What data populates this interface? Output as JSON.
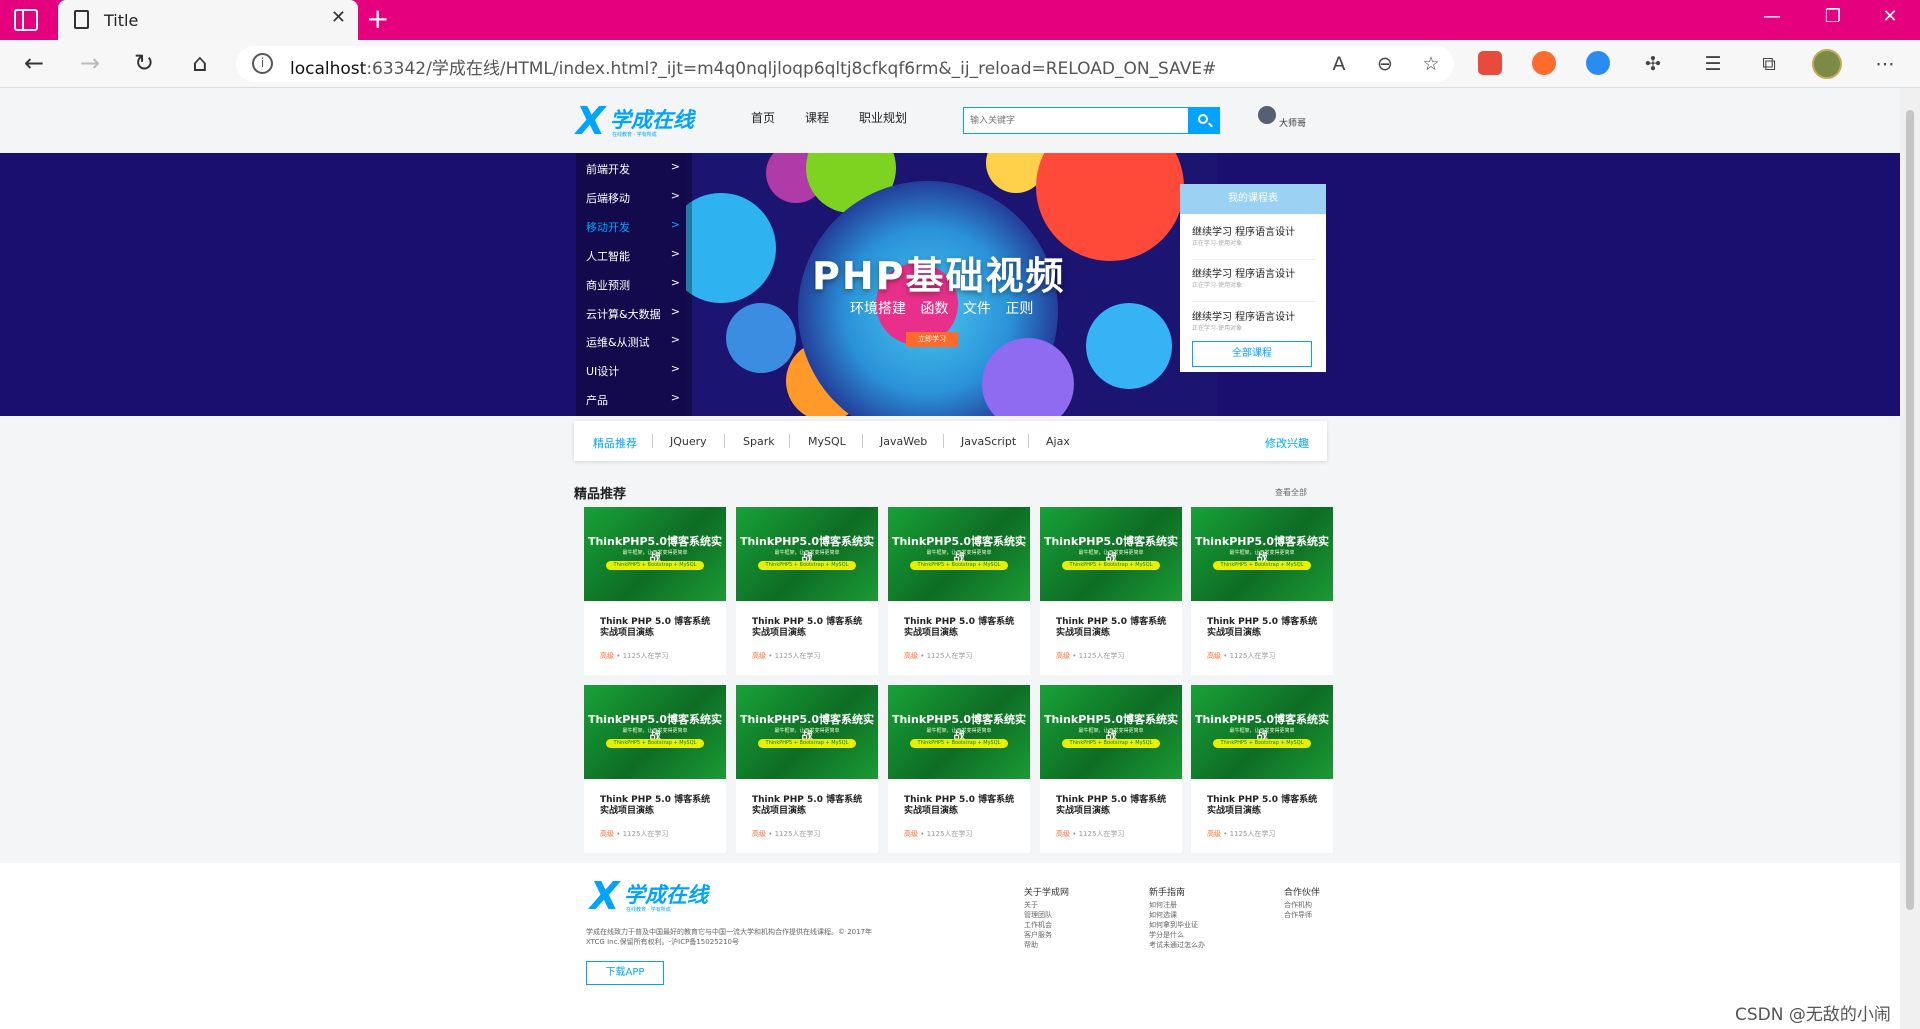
{
  "browser": {
    "tab_title": "Title",
    "url_host": "localhost",
    "url_rest": ":63342/学成在线/HTML/index.html?_ijt=m4q0nqljloqp6qltj8cfkqf6rm&_ij_reload=RELOAD_ON_SAVE#"
  },
  "header": {
    "logo_text": "学成在线",
    "logo_slogan": "在线教育 · 学有所成",
    "nav": [
      "首页",
      "课程",
      "职业规划"
    ],
    "search_placeholder": "输入关键字",
    "user_name": "大师哥"
  },
  "banner": {
    "side_menu": [
      {
        "label": "前端开发",
        "arrow": ">",
        "active": false
      },
      {
        "label": "后端移动",
        "arrow": ">",
        "active": false
      },
      {
        "label": "移动开发",
        "arrow": ">",
        "active": true
      },
      {
        "label": "人工智能",
        "arrow": ">",
        "active": false
      },
      {
        "label": "商业预测",
        "arrow": ">",
        "active": false
      },
      {
        "label": "云计算&大数据",
        "arrow": ">",
        "active": false
      },
      {
        "label": "运维&从测试",
        "arrow": ">",
        "active": false
      },
      {
        "label": "UI设计",
        "arrow": ">",
        "active": false
      },
      {
        "label": "产品",
        "arrow": ">",
        "active": false
      }
    ],
    "hero_title": "PHP基础视频",
    "hero_subtitle": "环境搭建 函数 文件 正则",
    "hero_button": "立即学习",
    "my_courses": {
      "title": "我的课程表",
      "items": [
        {
          "title": "继续学习 程序语言设计",
          "sub": "正在学习-使用对象"
        },
        {
          "title": "继续学习 程序语言设计",
          "sub": "正在学习-使用对象"
        },
        {
          "title": "继续学习 程序语言设计",
          "sub": "正在学习-使用对象"
        }
      ],
      "all_button": "全部课程"
    }
  },
  "subjects": {
    "items": [
      "精品推荐",
      "JQuery",
      "Spark",
      "MySQL",
      "JavaWeb",
      "JavaScript",
      "Ajax"
    ],
    "edit": "修改兴趣"
  },
  "section": {
    "title": "精品推荐",
    "view_all": "查看全部",
    "cards": [
      {
        "thumb_title": "ThinkPHP5.0博客系统实战",
        "thumb_sub": "最牛框架，让开发变得更简单",
        "thumb_tag": "ThinkPHP5 + Bootstrap + MySQL",
        "name": "Think PHP 5.0 博客系统实战项目演练",
        "level": "高级",
        "learners": " • 1125人在学习"
      },
      {
        "thumb_title": "ThinkPHP5.0博客系统实战",
        "thumb_sub": "最牛框架，让开发变得更简单",
        "thumb_tag": "ThinkPHP5 + Bootstrap + MySQL",
        "name": "Think PHP 5.0 博客系统实战项目演练",
        "level": "高级",
        "learners": " • 1125人在学习"
      },
      {
        "thumb_title": "ThinkPHP5.0博客系统实战",
        "thumb_sub": "最牛框架，让开发变得更简单",
        "thumb_tag": "ThinkPHP5 + Bootstrap + MySQL",
        "name": "Think PHP 5.0 博客系统实战项目演练",
        "level": "高级",
        "learners": " • 1125人在学习"
      },
      {
        "thumb_title": "ThinkPHP5.0博客系统实战",
        "thumb_sub": "最牛框架，让开发变得更简单",
        "thumb_tag": "ThinkPHP5 + Bootstrap + MySQL",
        "name": "Think PHP 5.0 博客系统实战项目演练",
        "level": "高级",
        "learners": " • 1125人在学习"
      },
      {
        "thumb_title": "ThinkPHP5.0博客系统实战",
        "thumb_sub": "最牛框架，让开发变得更简单",
        "thumb_tag": "ThinkPHP5 + Bootstrap + MySQL",
        "name": "Think PHP 5.0 博客系统实战项目演练",
        "level": "高级",
        "learners": " • 1125人在学习"
      },
      {
        "thumb_title": "ThinkPHP5.0博客系统实战",
        "thumb_sub": "最牛框架，让开发变得更简单",
        "thumb_tag": "ThinkPHP5 + Bootstrap + MySQL",
        "name": "Think PHP 5.0 博客系统实战项目演练",
        "level": "高级",
        "learners": " • 1125人在学习"
      },
      {
        "thumb_title": "ThinkPHP5.0博客系统实战",
        "thumb_sub": "最牛框架，让开发变得更简单",
        "thumb_tag": "ThinkPHP5 + Bootstrap + MySQL",
        "name": "Think PHP 5.0 博客系统实战项目演练",
        "level": "高级",
        "learners": " • 1125人在学习"
      },
      {
        "thumb_title": "ThinkPHP5.0博客系统实战",
        "thumb_sub": "最牛框架，让开发变得更简单",
        "thumb_tag": "ThinkPHP5 + Bootstrap + MySQL",
        "name": "Think PHP 5.0 博客系统实战项目演练",
        "level": "高级",
        "learners": " • 1125人在学习"
      },
      {
        "thumb_title": "ThinkPHP5.0博客系统实战",
        "thumb_sub": "最牛框架，让开发变得更简单",
        "thumb_tag": "ThinkPHP5 + Bootstrap + MySQL",
        "name": "Think PHP 5.0 博客系统实战项目演练",
        "level": "高级",
        "learners": " • 1125人在学习"
      },
      {
        "thumb_title": "ThinkPHP5.0博客系统实战",
        "thumb_sub": "最牛框架，让开发变得更简单",
        "thumb_tag": "ThinkPHP5 + Bootstrap + MySQL",
        "name": "Think PHP 5.0 博客系统实战项目演练",
        "level": "高级",
        "learners": " • 1125人在学习"
      }
    ]
  },
  "footer": {
    "description": "学成在线致力于普及中国最好的教育它与中国一流大学和机构合作提供在线课程。© 2017年XTCG Inc.保留所有权利。-沪ICP备15025210号",
    "download": "下载APP",
    "columns": [
      {
        "title": "关于学成网",
        "links": [
          "关于",
          "管理团队",
          "工作机会",
          "客户服务",
          "帮助"
        ]
      },
      {
        "title": "新手指南",
        "links": [
          "如何注册",
          "如何选课",
          "如何拿到毕业证",
          "学分是什么",
          "考试未通过怎么办"
        ]
      },
      {
        "title": "合作伙伴",
        "links": [
          "合作机构",
          "合作导师"
        ]
      }
    ]
  },
  "watermark": "CSDN @无敌的小闹",
  "colors": {
    "brand": "#00a4ff",
    "titlebar": "#e5007d",
    "banner_bg": "#1a0f6e",
    "accent_orange": "#ff6a2a"
  }
}
